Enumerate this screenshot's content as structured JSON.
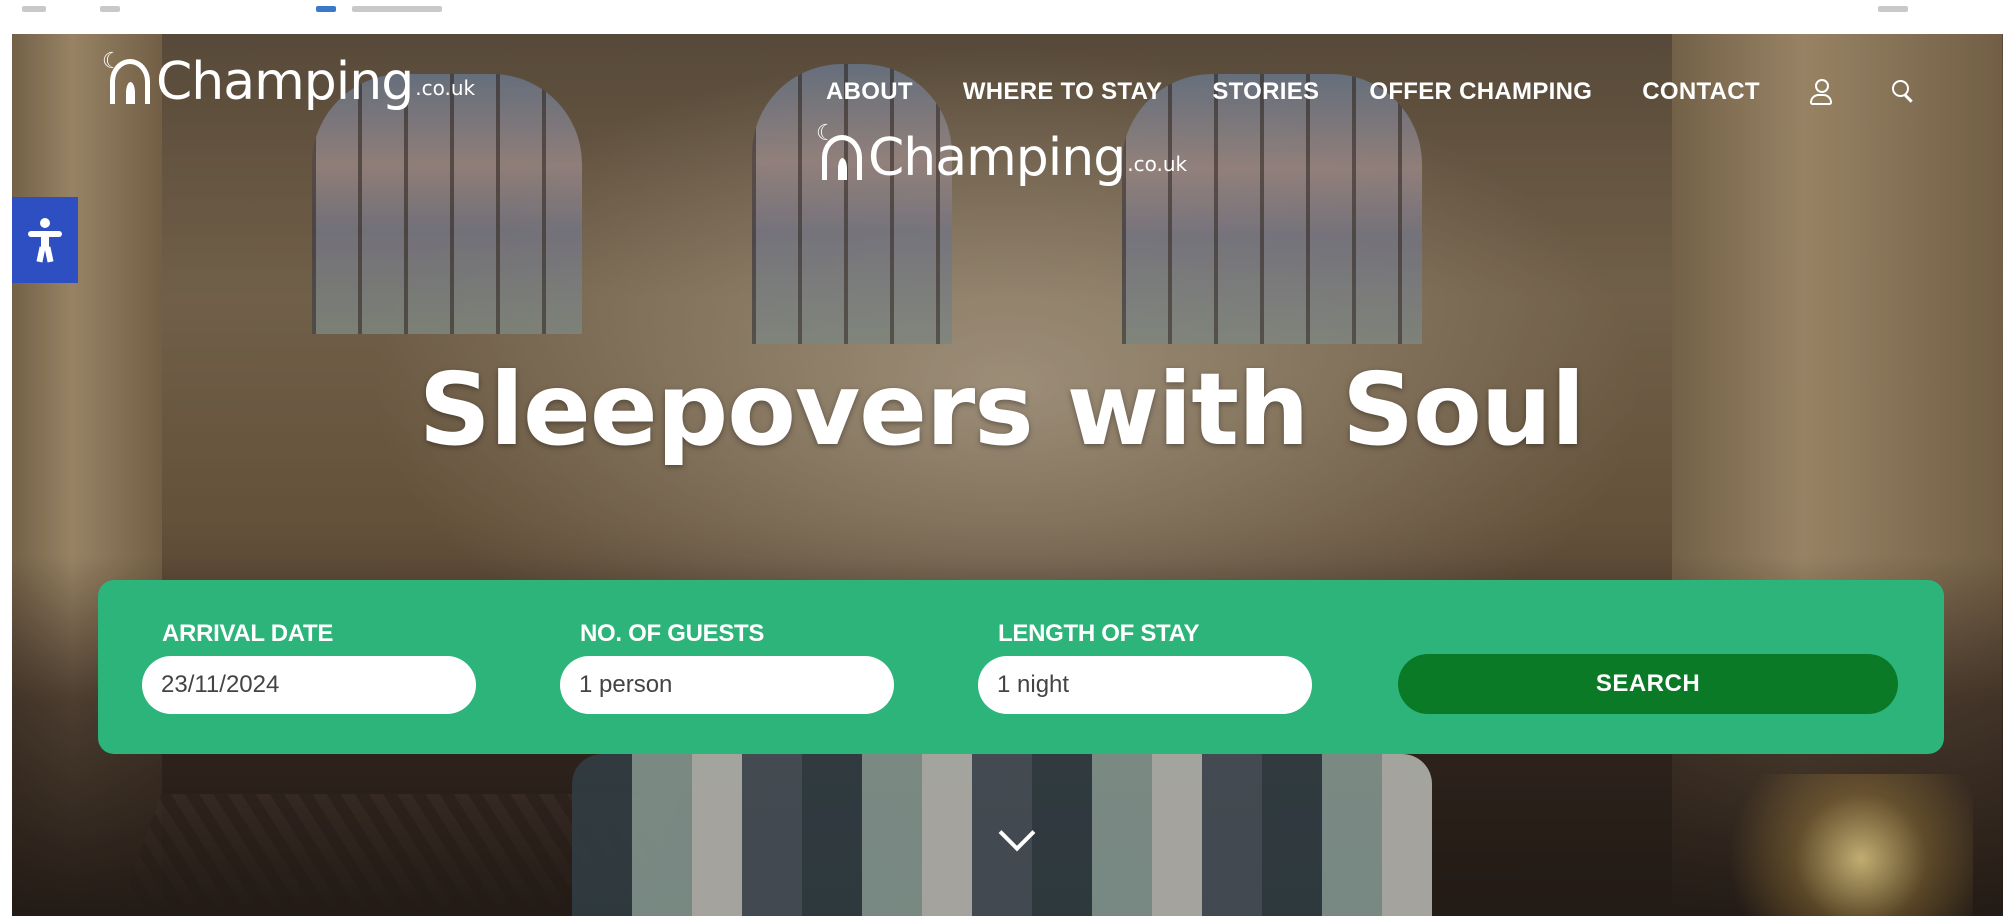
{
  "logo": {
    "brand": "Champing",
    "tld": ".co.uk",
    "trademark": "™"
  },
  "nav": {
    "items": [
      "ABOUT",
      "WHERE TO STAY",
      "STORIES",
      "OFFER CHAMPING",
      "CONTACT"
    ],
    "icons": [
      "user-icon",
      "search-icon"
    ]
  },
  "hero": {
    "headline": "Sleepovers with Soul"
  },
  "booking": {
    "arrival_label": "ARRIVAL DATE",
    "arrival_value": "23/11/2024",
    "guests_label": "NO. OF GUESTS",
    "guests_value": "1 person",
    "length_label": "LENGTH OF STAY",
    "length_value": "1 night",
    "search_label": "SEARCH"
  },
  "colors": {
    "booking_panel": "#2db47a",
    "search_button": "#0b7a27",
    "accessibility_button": "#2d4fc1"
  }
}
